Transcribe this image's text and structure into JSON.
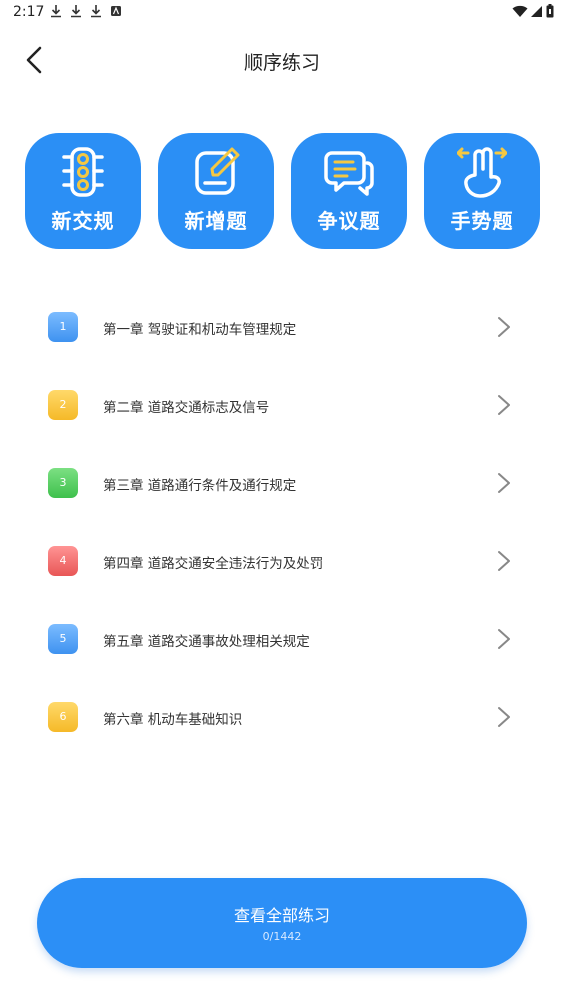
{
  "status_bar": {
    "time": "2:17"
  },
  "header": {
    "title": "顺序练习"
  },
  "categories": [
    {
      "label": "新交规",
      "icon": "traffic-light-icon"
    },
    {
      "label": "新增题",
      "icon": "edit-note-icon"
    },
    {
      "label": "争议题",
      "icon": "chat-bubbles-icon"
    },
    {
      "label": "手势题",
      "icon": "hand-gesture-icon"
    }
  ],
  "chapters": [
    {
      "num": "1",
      "label": "第一章  驾驶证和机动车管理规定",
      "color": "#4b9ef5"
    },
    {
      "num": "2",
      "label": "第二章  道路交通标志及信号",
      "color": "#f7c640"
    },
    {
      "num": "3",
      "label": "第三章  道路通行条件及通行规定",
      "color": "#4ccc5b"
    },
    {
      "num": "4",
      "label": "第四章  道路交通安全违法行为及处罚",
      "color": "#f06a6a"
    },
    {
      "num": "5",
      "label": "第五章  道路交通事故处理相关规定",
      "color": "#4b9ef5"
    },
    {
      "num": "6",
      "label": "第六章  机动车基础知识",
      "color": "#f7c640"
    }
  ],
  "footer": {
    "label": "查看全部练习",
    "count": "0/1442"
  },
  "colors": {
    "primary": "#2b8ff5",
    "accent_yellow": "#f5c842"
  }
}
